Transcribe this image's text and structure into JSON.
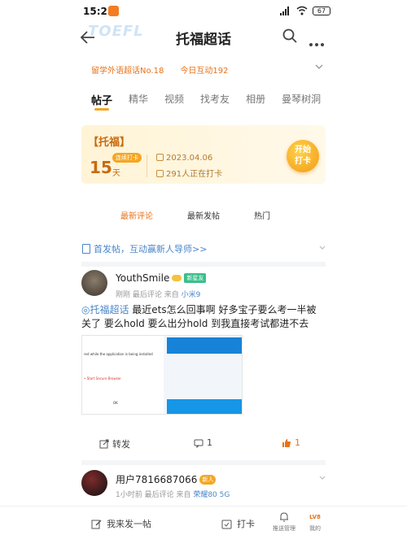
{
  "status_bar": {
    "time": "15:25",
    "battery": "67"
  },
  "header": {
    "watermark": "TOEFL",
    "title": "托福超话"
  },
  "stats": {
    "rank": "留学外语超话No.18",
    "interactions": "今日互动192"
  },
  "tabs": [
    "帖子",
    "精华",
    "视频",
    "找考友",
    "相册",
    "曼琴树洞"
  ],
  "checkin": {
    "tag": "【托福】",
    "badge": "连续打卡",
    "days": "15",
    "days_unit": "天",
    "date": "2023.04.06",
    "count": "291人正在打卡",
    "button_line1": "开始",
    "button_line2": "打卡"
  },
  "sort": [
    "最新评论",
    "最新发帖",
    "热门"
  ],
  "intro_link": "首发帖，互动赢新人导师>>",
  "post1": {
    "username": "YouthSmile",
    "badge": "新星友",
    "meta_prefix": "刚刚 最后评论 来自",
    "device": "小米9",
    "topic": "◎托福超话",
    "text": " 最近ets怎么回事啊 好多宝子要么考一半被关了 要么hold 要么出分hold 到我直接考试都进不去",
    "image_text1": "red while the application is being installed",
    "image_text2": "• Start Secure Browser",
    "image_ok": "OK",
    "share_label": "转发",
    "comment_count": "1",
    "like_count": "1"
  },
  "post2": {
    "username": "用户7816687066",
    "badge": "新人",
    "meta_prefix": "1小时前 最后评论 来自",
    "device": "荣耀80 5G"
  },
  "bottom_bar": {
    "compose": "我来发一帖",
    "checkin": "打卡",
    "notify": "推送管理",
    "mine": "我的",
    "level": "LV8"
  },
  "colors": {
    "accent": "#e8721b",
    "link": "#4a86c8",
    "checkin_bg": "#fff4d6"
  }
}
